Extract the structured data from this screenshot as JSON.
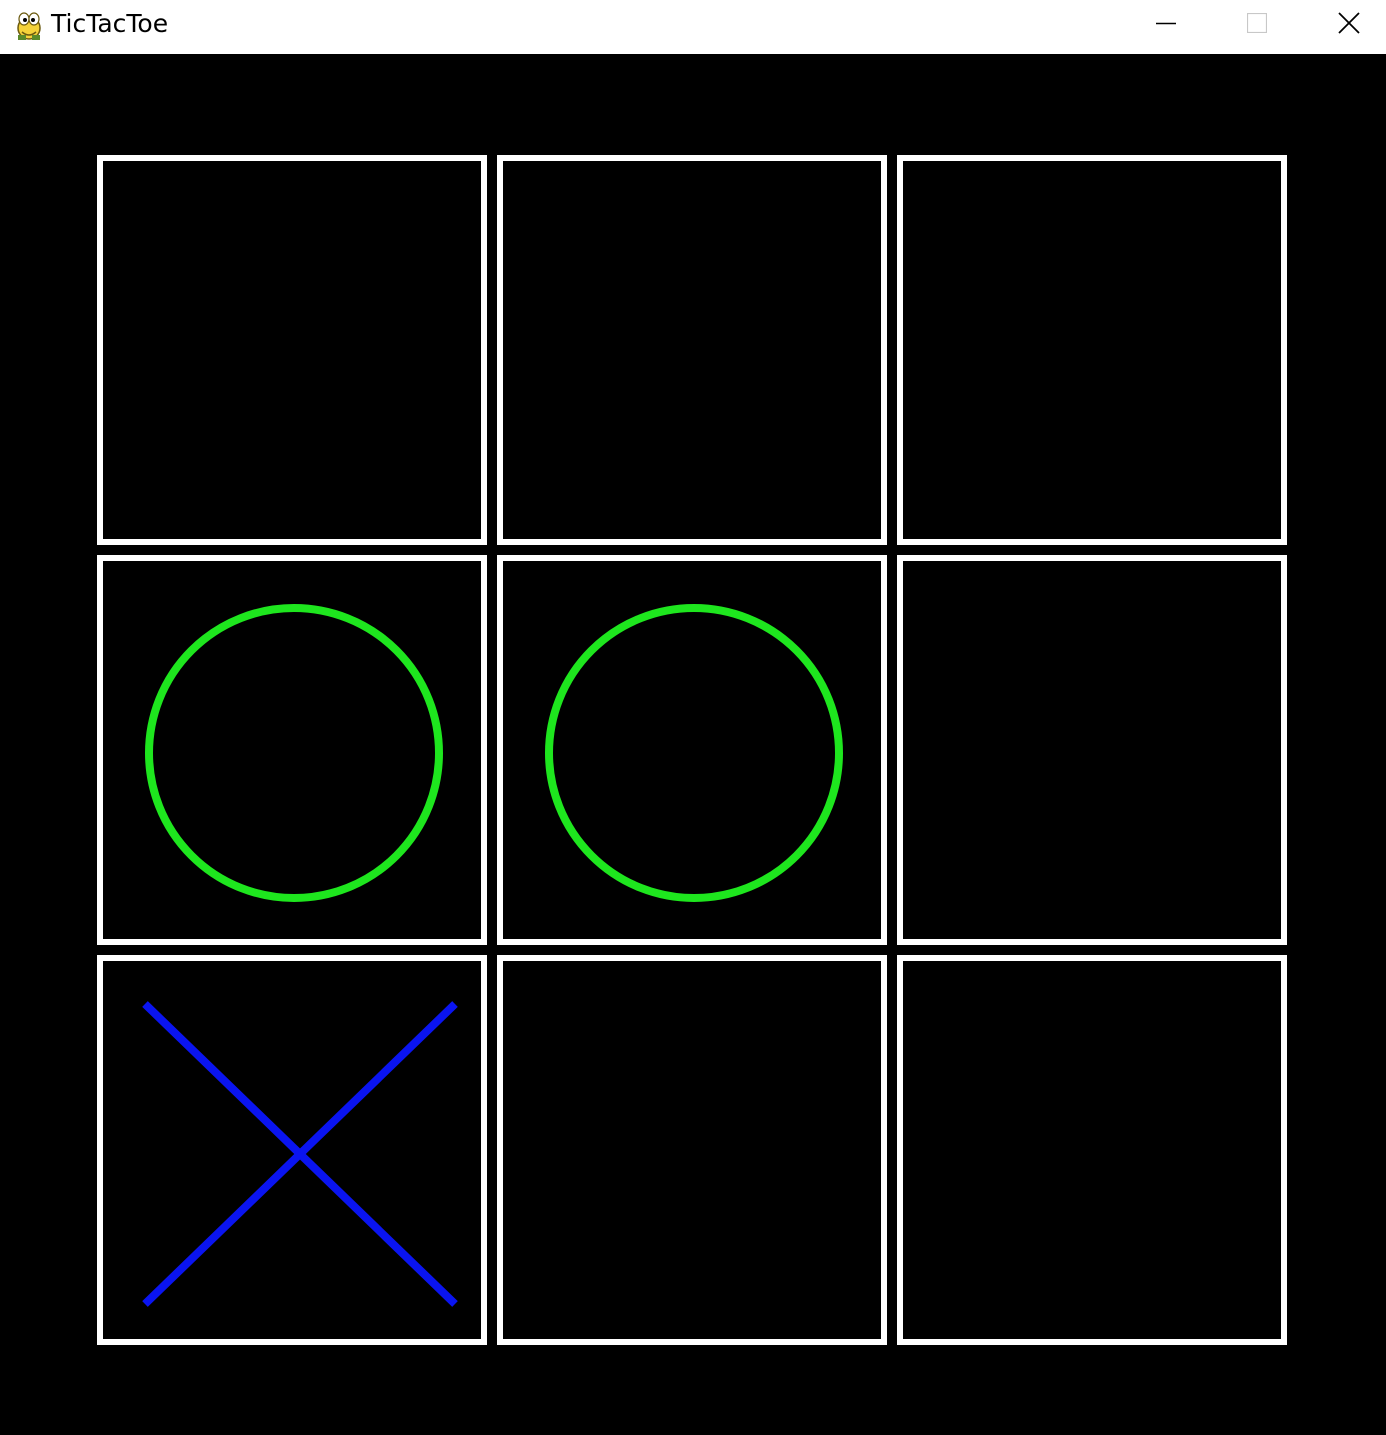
{
  "window": {
    "title": "TicTacToe",
    "app_icon": "pygame-snake-icon",
    "controls": {
      "minimize": "minimize-icon",
      "maximize": "maximize-icon",
      "close": "close-icon"
    }
  },
  "colors": {
    "background": "#000000",
    "grid_border": "#ffffff",
    "mark_o": "#1ee61e",
    "mark_x": "#0a14f0"
  },
  "board": {
    "rows": [
      [
        "",
        "",
        ""
      ],
      [
        "O",
        "O",
        ""
      ],
      [
        "X",
        "",
        ""
      ]
    ]
  }
}
